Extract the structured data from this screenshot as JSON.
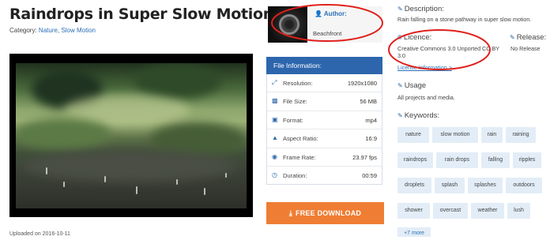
{
  "title": "Raindrops in Super Slow Motion",
  "category": {
    "label": "Category:",
    "links": [
      "Nature",
      "Slow Motion"
    ],
    "separator": ","
  },
  "author": {
    "label": "Author:",
    "name": "Beachfront"
  },
  "file_information": {
    "header": "File Information:",
    "rows": [
      {
        "icon": "expand-icon",
        "label": "Resolution:",
        "value": "1920x1080"
      },
      {
        "icon": "drive-icon",
        "label": "File Size:",
        "value": "56 MB"
      },
      {
        "icon": "film-icon",
        "label": "Format:",
        "value": "mp4"
      },
      {
        "icon": "aspect-icon",
        "label": "Aspect Ratio:",
        "value": "16:9"
      },
      {
        "icon": "camera-icon",
        "label": "Frame Rate:",
        "value": "23.97 fps"
      },
      {
        "icon": "clock-icon",
        "label": "Duration:",
        "value": "00:59"
      }
    ]
  },
  "download": {
    "label": "FREE DOWNLOAD",
    "icon": "download-icon"
  },
  "description": {
    "title": "Description:",
    "text": "Rain falling on a stone pathway in super slow motion."
  },
  "licence": {
    "title": "Licence:",
    "text": "Creative Commons 3.0 Unported CC BY 3.0",
    "link": "License Information >"
  },
  "release": {
    "title": "Release:",
    "text": "No Release"
  },
  "usage": {
    "title": "Usage",
    "text": "All projects and media."
  },
  "keywords": {
    "title": "Keywords:",
    "items": [
      "nature",
      "slow motion",
      "rain",
      "raining",
      "raindrops",
      "rain drops",
      "falling",
      "ripples",
      "droplets",
      "splash",
      "splashes",
      "outdoors",
      "shower",
      "overcast",
      "weather",
      "lush"
    ],
    "more": "+7 more"
  },
  "footer": {
    "left": "Uploaded on 2016-10-11",
    "right": ""
  },
  "colors": {
    "accent": "#2d66ad",
    "download": "#ef7d34",
    "annotation": "#e0201b",
    "keyword_bg": "#e3edf7"
  }
}
